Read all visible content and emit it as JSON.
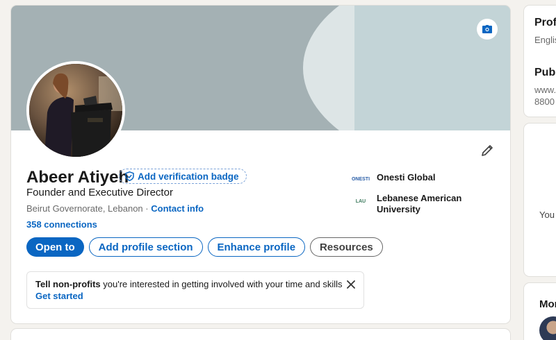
{
  "profile": {
    "name": "Abeer Atiyeh",
    "verification_label": "Add verification badge",
    "headline": "Founder and Executive Director",
    "location": "Beirut Governorate, Lebanon",
    "separator": "·",
    "contact_label": "Contact info",
    "connections": "358 connections"
  },
  "organizations": [
    {
      "name": "Onesti Global",
      "logo_text": "ONESTI",
      "logo_color": "#2b5fa8"
    },
    {
      "name": "Lebanese American University",
      "logo_text": "LAU",
      "logo_color": "#3d7a5e"
    }
  ],
  "actions": {
    "open_to": "Open to",
    "add_section": "Add profile section",
    "enhance": "Enhance profile",
    "resources": "Resources"
  },
  "notice": {
    "bold": "Tell non-profits",
    "rest": " you're interested in getting involved with your time and skills",
    "cta": "Get started"
  },
  "sidebar": {
    "card1_heading": "Prof",
    "card1_sub": "Englis",
    "card2_heading": "Publ",
    "card2_sub1": "www.",
    "card2_sub2": "8800",
    "card3_text": "You",
    "card4_heading": "Mor"
  },
  "icons": {
    "camera": "camera-icon",
    "edit": "pencil-icon",
    "verify": "shield-check-icon",
    "close": "close-icon"
  },
  "colors": {
    "brand": "#0a66c2",
    "banner": "#a4b1b4"
  }
}
